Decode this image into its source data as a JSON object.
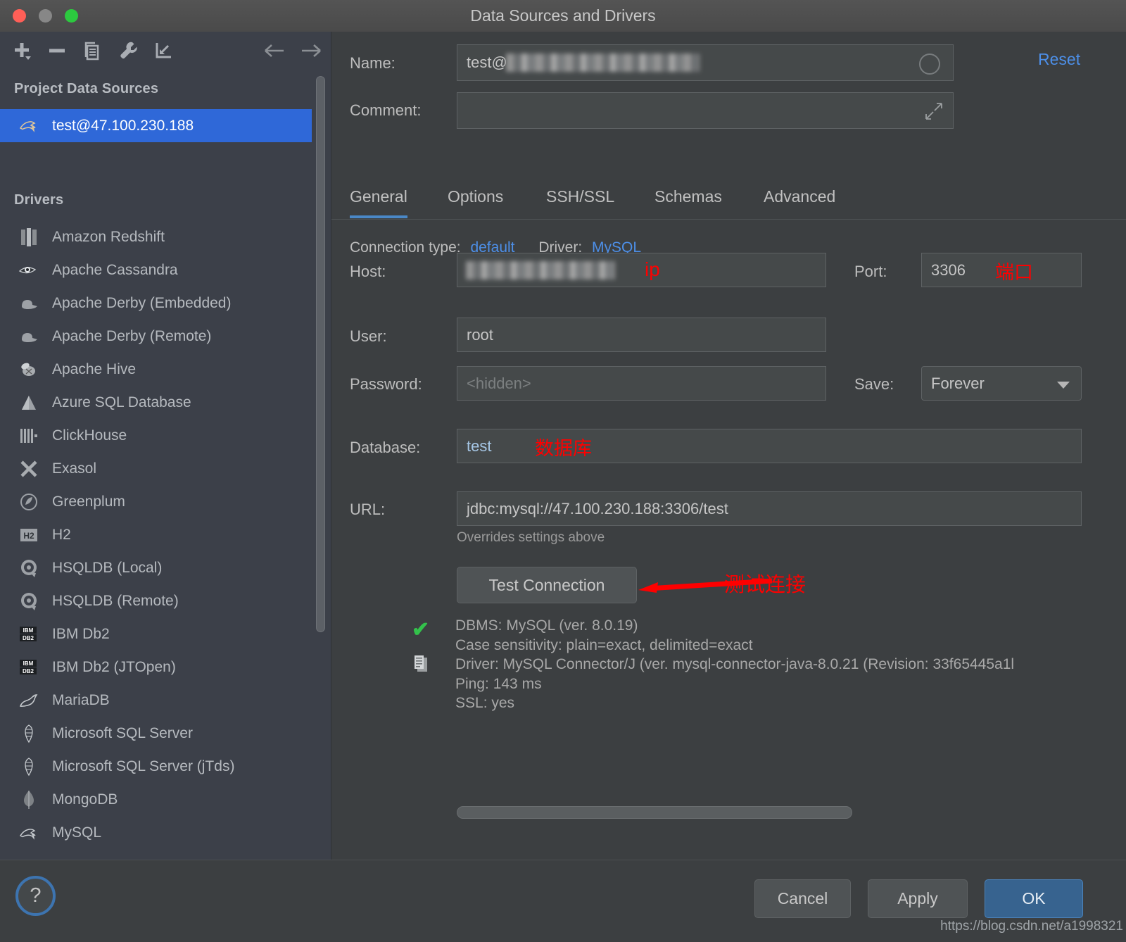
{
  "window": {
    "title": "Data Sources and Drivers",
    "traffic_lights": [
      "close",
      "minimize",
      "maximize"
    ]
  },
  "sidebar": {
    "toolbar": [
      {
        "name": "add-data-source-button",
        "icon": "plus-dropdown-icon"
      },
      {
        "name": "remove-data-source-button",
        "icon": "minus-icon"
      },
      {
        "name": "duplicate-data-source-button",
        "icon": "copy-icon"
      },
      {
        "name": "properties-button",
        "icon": "wrench-icon"
      },
      {
        "name": "import-button",
        "icon": "import-arrow-icon"
      },
      {
        "name": "nav-back-button",
        "icon": "arrow-left-icon"
      },
      {
        "name": "nav-forward-button",
        "icon": "arrow-right-icon"
      }
    ],
    "project_data_sources_title": "Project Data Sources",
    "data_sources": [
      {
        "label": "test@47.100.230.188",
        "icon": "mysql-dolphin-icon",
        "selected": true
      }
    ],
    "drivers_title": "Drivers",
    "drivers": [
      {
        "label": "Amazon Redshift",
        "icon": "redshift-icon"
      },
      {
        "label": "Apache Cassandra",
        "icon": "cassandra-eye-icon"
      },
      {
        "label": "Apache Derby (Embedded)",
        "icon": "derby-hat-icon"
      },
      {
        "label": "Apache Derby (Remote)",
        "icon": "derby-hat-icon"
      },
      {
        "label": "Apache Hive",
        "icon": "hive-bee-icon"
      },
      {
        "label": "Azure SQL Database",
        "icon": "azure-icon"
      },
      {
        "label": "ClickHouse",
        "icon": "clickhouse-icon"
      },
      {
        "label": "Exasol",
        "icon": "exasol-x-icon"
      },
      {
        "label": "Greenplum",
        "icon": "greenplum-icon"
      },
      {
        "label": "H2",
        "icon": "h2-icon"
      },
      {
        "label": "HSQLDB (Local)",
        "icon": "hsqldb-icon"
      },
      {
        "label": "HSQLDB (Remote)",
        "icon": "hsqldb-icon"
      },
      {
        "label": "IBM Db2",
        "icon": "ibm-db2-icon"
      },
      {
        "label": "IBM Db2 (JTOpen)",
        "icon": "ibm-db2-icon"
      },
      {
        "label": "MariaDB",
        "icon": "mariadb-seal-icon"
      },
      {
        "label": "Microsoft SQL Server",
        "icon": "mssql-icon"
      },
      {
        "label": "Microsoft SQL Server (jTds)",
        "icon": "mssql-icon"
      },
      {
        "label": "MongoDB",
        "icon": "mongodb-leaf-icon"
      },
      {
        "label": "MySQL",
        "icon": "mysql-dolphin-icon"
      }
    ]
  },
  "detail": {
    "name_label": "Name:",
    "name_value_prefix": "test@",
    "name_value_redacted": true,
    "comment_label": "Comment:",
    "comment_value": "",
    "reset_label": "Reset",
    "tabs": [
      {
        "label": "General",
        "active": true
      },
      {
        "label": "Options",
        "active": false
      },
      {
        "label": "SSH/SSL",
        "active": false
      },
      {
        "label": "Schemas",
        "active": false
      },
      {
        "label": "Advanced",
        "active": false
      }
    ],
    "connection_type_label": "Connection type:",
    "connection_type_value": "default",
    "driver_label": "Driver:",
    "driver_value": "MySQL",
    "host_label": "Host:",
    "host_value_redacted": true,
    "host_annotation": "ip",
    "port_label": "Port:",
    "port_value": "3306",
    "port_annotation": "端口",
    "user_label": "User:",
    "user_value": "root",
    "password_label": "Password:",
    "password_placeholder": "<hidden>",
    "save_label": "Save:",
    "save_value": "Forever",
    "database_label": "Database:",
    "database_value": "test",
    "database_annotation": "数据库",
    "url_label": "URL:",
    "url_value": "jdbc:mysql://47.100.230.188:3306/test",
    "overrides_note": "Overrides settings above",
    "test_connection_label": "Test Connection",
    "test_connection_annotation": "测试连接",
    "result_lines": [
      "DBMS: MySQL (ver. 8.0.19)",
      "Case sensitivity: plain=exact, delimited=exact",
      "Driver: MySQL Connector/J (ver. mysql-connector-java-8.0.21 (Revision: 33f65445a1l",
      "Ping: 143 ms",
      "SSL: yes"
    ],
    "result_status_icon": "green-check-icon",
    "copy_icon": "copy-result-icon"
  },
  "footer": {
    "help_label": "?",
    "cancel_label": "Cancel",
    "apply_label": "Apply",
    "ok_label": "OK",
    "watermark": "https://blog.csdn.net/a1998321"
  },
  "colors": {
    "accent_blue": "#4d8fe8",
    "selection_blue": "#2f68d8",
    "annotation_red": "#fe0000",
    "success_green": "#33c14b",
    "panel_bg": "#3c3f41",
    "sidebar_bg": "#3c4049"
  }
}
